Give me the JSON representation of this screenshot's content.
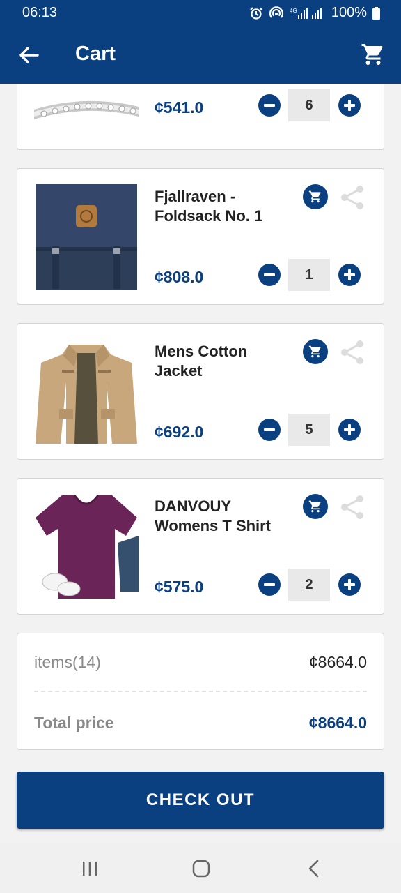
{
  "status_bar": {
    "time": "06:13",
    "battery": "100%"
  },
  "app_bar": {
    "title": "Cart",
    "back_icon": "arrow-back-icon",
    "cart_icon": "shopping-cart-icon"
  },
  "cart_items": [
    {
      "name": "",
      "price": "¢541.0",
      "quantity": "6",
      "image": "bracelet"
    },
    {
      "name": "Fjallraven - Foldsack No. 1",
      "price": "¢808.0",
      "quantity": "1",
      "image": "backpack"
    },
    {
      "name": "Mens Cotton Jacket",
      "price": "¢692.0",
      "quantity": "5",
      "image": "jacket"
    },
    {
      "name": "DANVOUY Womens T Shirt",
      "price": "¢575.0",
      "quantity": "2",
      "image": "tshirt"
    }
  ],
  "summary": {
    "items_label": "items(14)",
    "items_total": "¢8664.0",
    "total_label": "Total price",
    "total_value": "¢8664.0"
  },
  "checkout_label": "CHECK OUT",
  "colors": {
    "primary": "#0b4080",
    "background": "#f2f2f2",
    "share_icon": "#d9d9d9"
  }
}
